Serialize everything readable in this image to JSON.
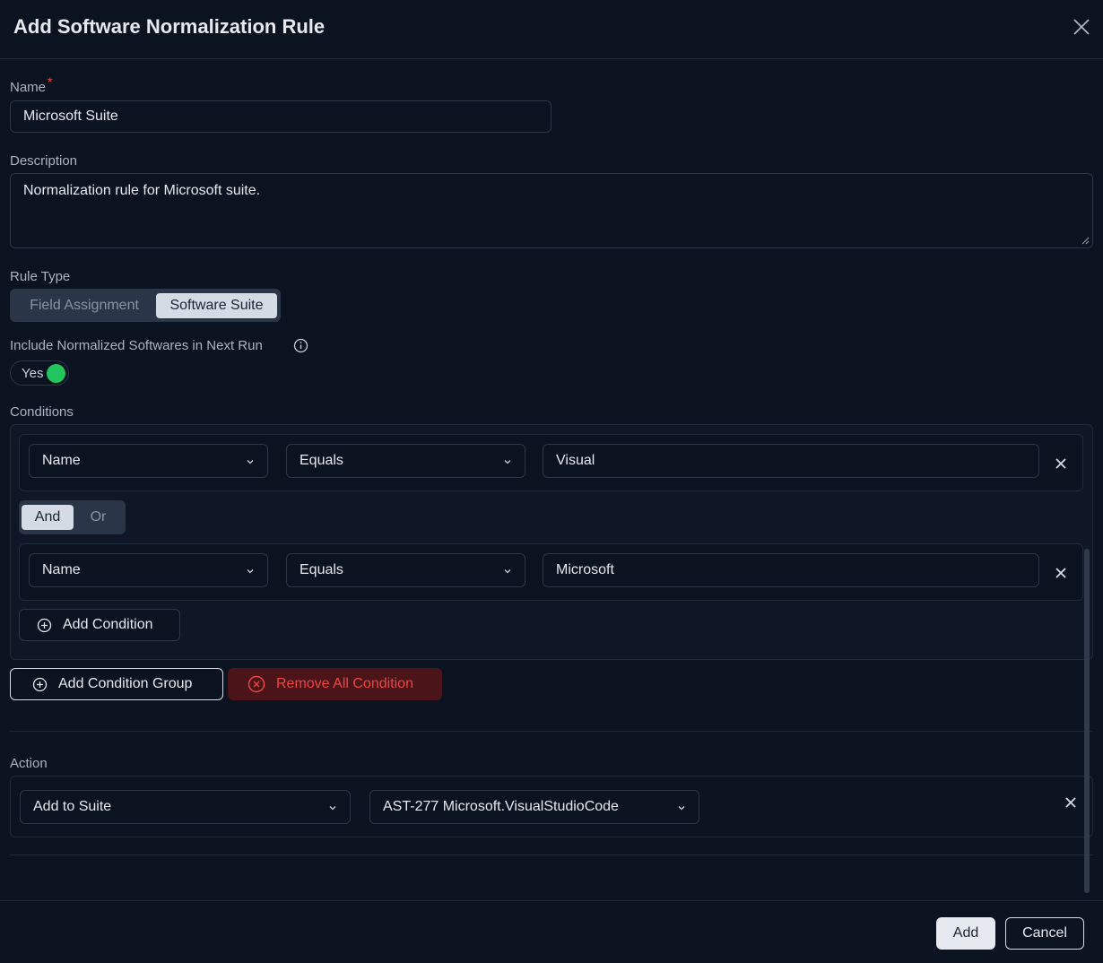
{
  "dialog": {
    "title": "Add Software Normalization Rule"
  },
  "name_field": {
    "label": "Name",
    "required_mark": "*",
    "value": "Microsoft Suite"
  },
  "description_field": {
    "label": "Description",
    "value": "Normalization rule for Microsoft suite."
  },
  "rule_type": {
    "label": "Rule Type",
    "options": [
      "Field Assignment",
      "Software Suite"
    ],
    "selected": "Software Suite"
  },
  "include_next_run": {
    "label": "Include Normalized Softwares in Next Run",
    "toggle_label": "Yes",
    "toggle_on": true,
    "toggle_color": "#22c55e"
  },
  "conditions": {
    "label": "Conditions",
    "rows": [
      {
        "field": "Name",
        "operator": "Equals",
        "value": "Visual"
      },
      {
        "field": "Name",
        "operator": "Equals",
        "value": "Microsoft"
      }
    ],
    "logic": {
      "options": [
        "And",
        "Or"
      ],
      "selected": "And"
    },
    "add_condition_label": "Add Condition",
    "add_group_label": "Add Condition Group",
    "remove_all_label": "Remove All Condition",
    "danger_color": "#ef4444"
  },
  "action": {
    "label": "Action",
    "type": "Add to Suite",
    "target": "AST-277 Microsoft.VisualStudioCode"
  },
  "footer": {
    "add_label": "Add",
    "cancel_label": "Cancel"
  },
  "icons": {
    "close": "close-icon",
    "info": "info-icon",
    "chevron": "chevron-down-icon",
    "plus_circle": "plus-circle-icon",
    "x_circle": "x-circle-icon"
  }
}
